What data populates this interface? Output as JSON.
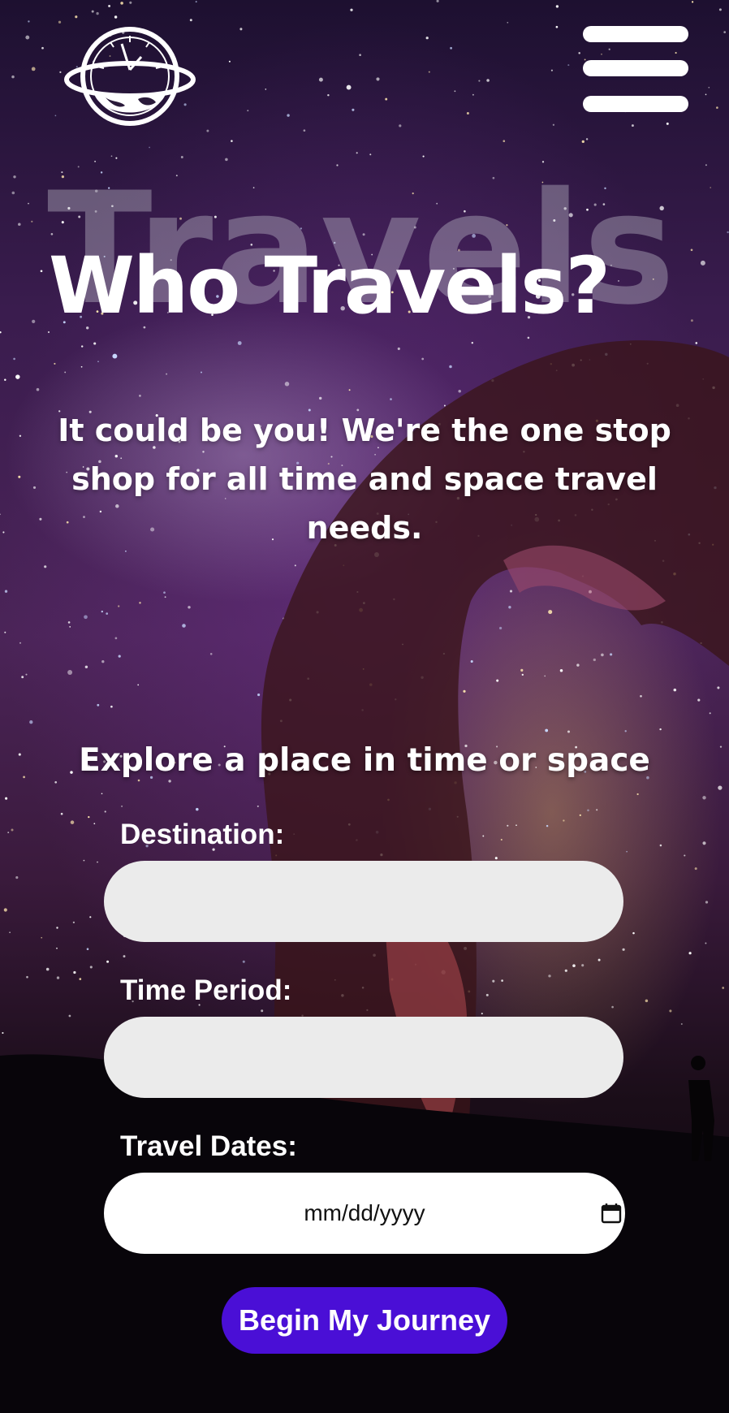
{
  "header": {
    "logo_icon": "time-space-globe-clock-icon",
    "menu_icon": "hamburger-menu-icon"
  },
  "hero": {
    "watermark": "Travels",
    "title": "Who Travels?",
    "subtitle": "It could be you! We're the one stop shop for all time and space travel needs."
  },
  "form": {
    "title": "Explore a place in time or space",
    "destination": {
      "label": "Destination:",
      "value": "",
      "placeholder": ""
    },
    "time_period": {
      "label": "Time Period:",
      "value": "",
      "placeholder": ""
    },
    "travel_dates": {
      "label": "Travel Dates:",
      "placeholder": "mm/dd/yyyy",
      "icon": "calendar-icon"
    },
    "submit_label": "Begin My Journey"
  },
  "colors": {
    "button": "#4a0fd6",
    "input_grey": "#ebebeb",
    "text": "#ffffff"
  }
}
